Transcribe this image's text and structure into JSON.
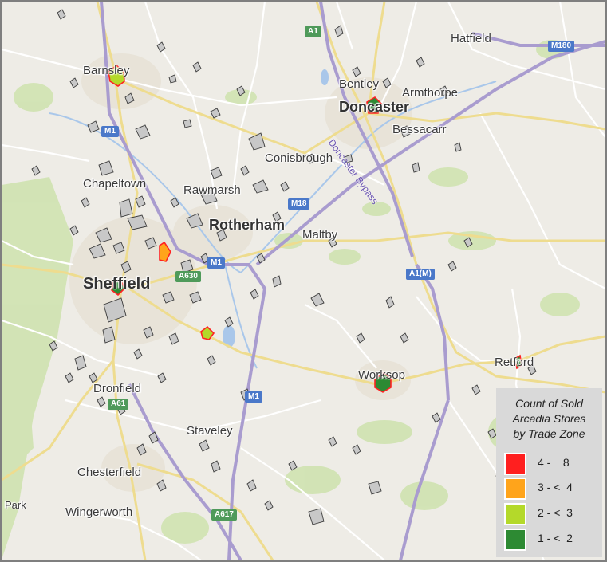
{
  "places": [
    {
      "id": "barnsley",
      "text": "Barnsley"
    },
    {
      "id": "bentley",
      "text": "Bentley"
    },
    {
      "id": "doncaster",
      "text": "Doncaster"
    },
    {
      "id": "armthorpe",
      "text": "Armthorpe"
    },
    {
      "id": "hatfield",
      "text": "Hatfield"
    },
    {
      "id": "bessacarr",
      "text": "Bessacarr"
    },
    {
      "id": "conisbrough",
      "text": "Conisbrough"
    },
    {
      "id": "chapeltown",
      "text": "Chapeltown"
    },
    {
      "id": "rawmarsh",
      "text": "Rawmarsh"
    },
    {
      "id": "rotherham",
      "text": "Rotherham"
    },
    {
      "id": "maltby",
      "text": "Maltby"
    },
    {
      "id": "sheffield",
      "text": "Sheffield"
    },
    {
      "id": "worksop",
      "text": "Worksop"
    },
    {
      "id": "retford",
      "text": "Retford"
    },
    {
      "id": "dronfield",
      "text": "Dronfield"
    },
    {
      "id": "staveley",
      "text": "Staveley"
    },
    {
      "id": "chesterfield",
      "text": "Chesterfield"
    },
    {
      "id": "wingerworth",
      "text": "Wingerworth"
    },
    {
      "id": "park",
      "text": "Park"
    }
  ],
  "road_labels": {
    "a1": "A1",
    "m180": "M180",
    "m1_north": "M1",
    "m18": "M18",
    "m1_central": "M1",
    "a1m": "A1(M)",
    "a630": "A630",
    "m1_south": "M1",
    "a61": "A61",
    "a617": "A617",
    "doncaster_bypass": "Doncaster Bypass"
  },
  "legend": {
    "title_lines": [
      "Count of Sold",
      "Arcadia Stores",
      "by Trade Zone"
    ],
    "items": [
      {
        "label": "4 -    8",
        "color": "#ff1f1f"
      },
      {
        "label": "3 - <  4",
        "color": "#ffa41b"
      },
      {
        "label": "2 - <  3",
        "color": "#b4d92a"
      },
      {
        "label": "1 - <  2",
        "color": "#2d8a33"
      }
    ]
  },
  "colors": {
    "trade_zone_outline": "#ff2222",
    "empty_zone_fill": "#c8c8c8",
    "motorway": "#a99ccf",
    "major_road": "#e6d99a",
    "minor_road": "#ffffff",
    "water": "#a9c7ea",
    "green_area": "#cfe3b0"
  }
}
